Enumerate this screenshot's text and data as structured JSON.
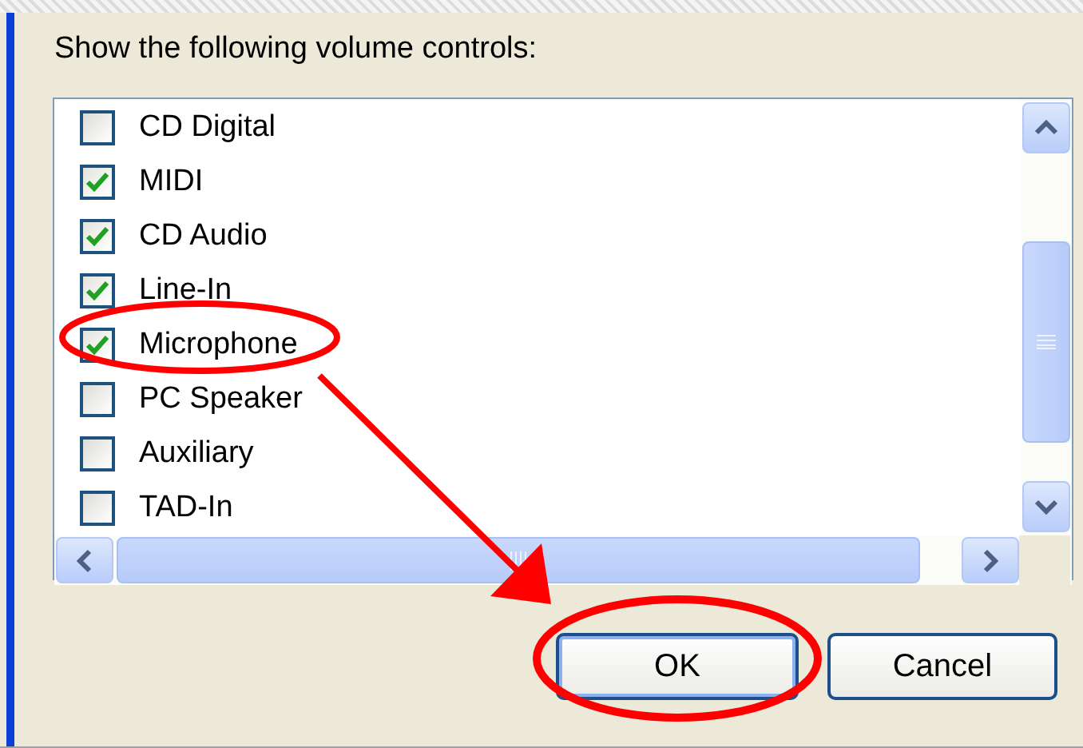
{
  "label": "Show the following volume controls:",
  "controls": [
    {
      "name": "CD Digital",
      "checked": false
    },
    {
      "name": "MIDI",
      "checked": true
    },
    {
      "name": "CD Audio",
      "checked": true
    },
    {
      "name": "Line-In",
      "checked": true
    },
    {
      "name": "Microphone",
      "checked": true
    },
    {
      "name": "PC Speaker",
      "checked": false
    },
    {
      "name": "Auxiliary",
      "checked": false
    },
    {
      "name": "TAD-In",
      "checked": false
    }
  ],
  "buttons": [
    {
      "label": "OK",
      "focused": true
    },
    {
      "label": "Cancel",
      "focused": false
    }
  ]
}
